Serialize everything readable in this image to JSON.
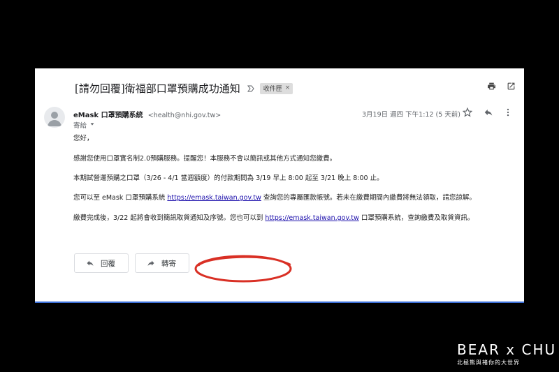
{
  "email": {
    "subject": "[請勿回覆]衛福部口罩預購成功通知",
    "label": "收件匣",
    "sender_name": "eMask 口罩預購系統",
    "sender_email": "<health@nhi.gov.tw>",
    "to_label": "寄給",
    "date": "3月19日 週四 下午1:12 (5 天前)",
    "body": {
      "greeting": "您好，",
      "line2": "感謝您使用口罩實名制2.0預購服務。提醒您！本服務不會以簡訊或其他方式通知您繳費。",
      "line3": "本期試營運預購之口罩（3/26 - 4/1 當週額度）的付款期間為 3/19 早上 8:00 起至 3/21 晚上 8:00 止。",
      "line4_a": "您可以至 eMask 口罩預購系統 ",
      "line4_link": "https://emask.taiwan.gov.tw",
      "line4_b": " 查詢您的專屬匯款帳號。若未在繳費期間內繳費將無法領取，請您諒解。",
      "line5_a": "繳費完成後，3/22 起將會收到簡訊取貨通知及序號。您也可以到 ",
      "line5_link": "https://emask.taiwan.gov.tw",
      "line5_b": " 口罩預購系統，查詢繳費及取貨資訊。"
    }
  },
  "buttons": {
    "reply": "回覆",
    "forward": "轉寄"
  },
  "icons": {
    "print": "print-icon",
    "open_new": "open-in-new-icon",
    "star": "star-icon",
    "reply": "reply-icon",
    "more": "more-vert-icon",
    "important": "important-marker-icon"
  },
  "watermark": {
    "title": "BEAR x CHU",
    "subtitle": "北極熊與褚你的大世界"
  },
  "colors": {
    "link": "#1a0dab",
    "annotation": "#d93025",
    "background": "#000000"
  }
}
